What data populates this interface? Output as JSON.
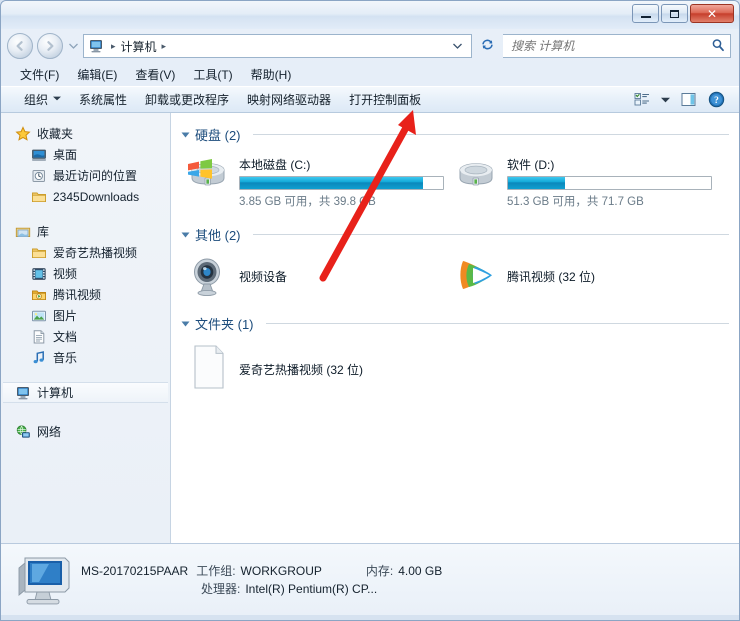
{
  "window": {
    "controls": {
      "minimize": "—",
      "maximize": "□",
      "close": "✕"
    }
  },
  "address": {
    "back_glyph": "◀",
    "forward_glyph": "▶",
    "history_caret": "▾",
    "computer_icon": "computer-icon",
    "crumb_root": "计算机",
    "sep": "▸",
    "dropdown_caret": "▾",
    "refresh_glyph": "↻"
  },
  "search": {
    "placeholder": "搜索 计算机",
    "value": "",
    "icon": "search-icon"
  },
  "menubar": {
    "items": [
      {
        "label": "文件(F)"
      },
      {
        "label": "编辑(E)"
      },
      {
        "label": "查看(V)"
      },
      {
        "label": "工具(T)"
      },
      {
        "label": "帮助(H)"
      }
    ]
  },
  "toolbar": {
    "organize": "组织",
    "organize_caret": "▼",
    "buttons": [
      {
        "label": "系统属性"
      },
      {
        "label": "卸载或更改程序"
      },
      {
        "label": "映射网络驱动器"
      },
      {
        "label": "打开控制面板"
      }
    ],
    "view_caret": "▼",
    "help_glyph": "?"
  },
  "sidebar": {
    "groups": [
      {
        "name": "favorites",
        "header": {
          "label": "收藏夹",
          "icon": "star-icon"
        },
        "items": [
          {
            "label": "桌面",
            "icon": "desktop-icon"
          },
          {
            "label": "最近访问的位置",
            "icon": "recent-places-icon"
          },
          {
            "label": "2345Downloads",
            "icon": "folder-icon"
          }
        ]
      },
      {
        "name": "libraries",
        "header": {
          "label": "库",
          "icon": "library-icon"
        },
        "items": [
          {
            "label": "爱奇艺热播视频",
            "icon": "folder-icon"
          },
          {
            "label": "视频",
            "icon": "video-icon"
          },
          {
            "label": "腾讯视频",
            "icon": "folder-video-icon"
          },
          {
            "label": "图片",
            "icon": "picture-icon"
          },
          {
            "label": "文档",
            "icon": "document-icon"
          },
          {
            "label": "音乐",
            "icon": "music-icon"
          }
        ]
      },
      {
        "name": "computer",
        "header": {
          "label": "计算机",
          "icon": "computer-icon",
          "selected": true
        },
        "items": []
      },
      {
        "name": "network",
        "header": {
          "label": "网络",
          "icon": "network-icon"
        },
        "items": []
      }
    ]
  },
  "content": {
    "groups": [
      {
        "title": "硬盘 (2)",
        "kind": "drives",
        "items": [
          {
            "name": "本地磁盘 (C:)",
            "icon": "system-drive-icon",
            "sub": "3.85 GB 可用，共 39.8 GB",
            "used_percent": 90,
            "bar_color": "#12a8d8"
          },
          {
            "name": "软件 (D:)",
            "icon": "drive-icon",
            "sub": "51.3 GB 可用，共 71.7 GB",
            "used_percent": 28,
            "bar_color": "#12a8d8"
          }
        ]
      },
      {
        "title": "其他 (2)",
        "kind": "simple",
        "items": [
          {
            "name": "视频设备",
            "icon": "webcam-icon"
          },
          {
            "name": "腾讯视频 (32 位)",
            "icon": "tencent-video-icon"
          }
        ]
      },
      {
        "title": "文件夹 (1)",
        "kind": "simple",
        "items": [
          {
            "name": "爱奇艺热播视频 (32 位)",
            "icon": "blank-file-icon"
          }
        ]
      }
    ]
  },
  "details": {
    "icon": "computer-large-icon",
    "machine_name": "MS-20170215PAAR",
    "workgroup_label": "工作组:",
    "workgroup_value": "WORKGROUP",
    "memory_label": "内存:",
    "memory_value": "4.00 GB",
    "cpu_label": "处理器:",
    "cpu_value": "Intel(R) Pentium(R) CP..."
  },
  "annotation": {
    "color": "#e8211a",
    "kind": "pointer-arrow",
    "points_to": "打开控制面板"
  }
}
